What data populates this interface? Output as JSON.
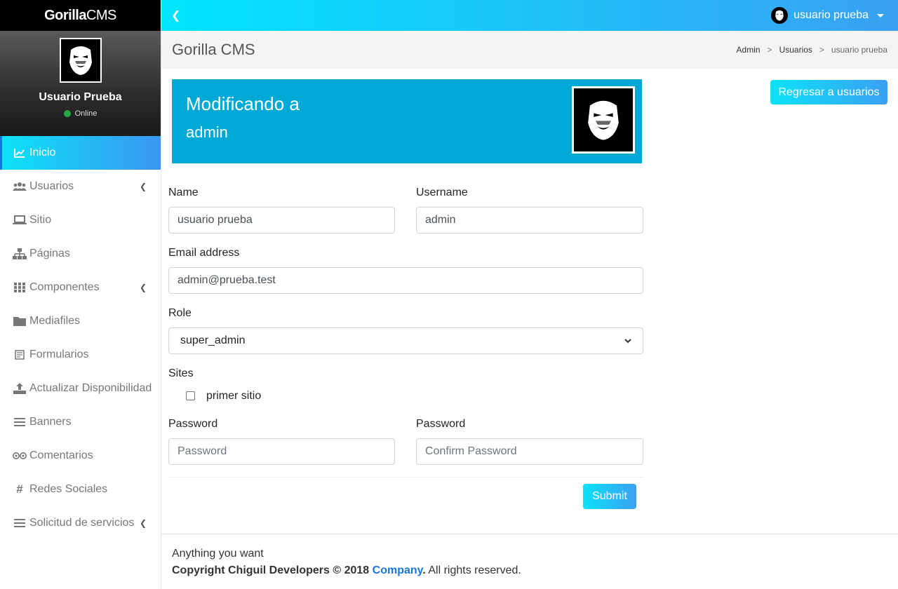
{
  "sidebar": {
    "brand_bold": "Gorilla",
    "brand_light": "CMS",
    "user_name": "Usuario Prueba",
    "status": "Online",
    "items": [
      {
        "label": "Inicio",
        "icon": "chart-line-icon",
        "active": true,
        "has_children": false
      },
      {
        "label": "Usuarios",
        "icon": "users-icon",
        "active": false,
        "has_children": true
      },
      {
        "label": "Sitio",
        "icon": "laptop-icon",
        "active": false,
        "has_children": false
      },
      {
        "label": "Páginas",
        "icon": "sitemap-icon",
        "active": false,
        "has_children": false
      },
      {
        "label": "Componentes",
        "icon": "grid-icon",
        "active": false,
        "has_children": true
      },
      {
        "label": "Mediafiles",
        "icon": "folder-icon",
        "active": false,
        "has_children": false
      },
      {
        "label": "Formularios",
        "icon": "form-icon",
        "active": false,
        "has_children": false
      },
      {
        "label": "Actualizar Disponibilidad",
        "icon": "upload-icon",
        "active": false,
        "has_children": false
      },
      {
        "label": "Banners",
        "icon": "bars-icon",
        "active": false,
        "has_children": false
      },
      {
        "label": "Comentarios",
        "icon": "tripadvisor-icon",
        "active": false,
        "has_children": false
      },
      {
        "label": "Redes Sociales",
        "icon": "hashtag-icon",
        "active": false,
        "has_children": false
      },
      {
        "label": "Solicitud de servicios",
        "icon": "bars-icon",
        "active": false,
        "has_children": true
      }
    ]
  },
  "topbar": {
    "user_name": "usuario prueba"
  },
  "header": {
    "title": "Gorilla CMS",
    "breadcrumb": [
      "Admin",
      "Usuarios",
      "usuario prueba"
    ],
    "separator": ">"
  },
  "banner": {
    "title": "Modificando a",
    "subtitle": "admin"
  },
  "back_button": "Regresar a usuarios",
  "form": {
    "name_label": "Name",
    "name_value": "usuario prueba",
    "username_label": "Username",
    "username_value": "admin",
    "email_label": "Email address",
    "email_value": "admin@prueba.test",
    "role_label": "Role",
    "role_value": "super_admin",
    "sites_label": "Sites",
    "site_option": "primer sitio",
    "site_checked": false,
    "password_label": "Password",
    "password_placeholder": "Password",
    "confirm_label": "Password",
    "confirm_placeholder": "Confirm Password",
    "submit": "Submit"
  },
  "footer": {
    "line1": "Anything you want",
    "copyright": "Copyright Chiguil Developers © 2018",
    "company": "Company",
    "period": ".",
    "rights": "All rights reserved."
  },
  "colors": {
    "accent_gradient_start": "#0ce2f8",
    "accent_gradient_end": "#3aa0f2",
    "banner": "#00a8d6",
    "online": "#28a745",
    "link": "#1a73d9"
  }
}
